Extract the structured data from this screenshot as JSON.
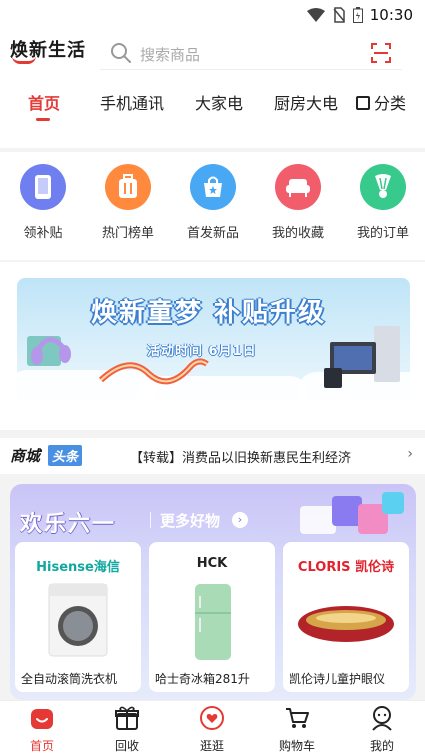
{
  "status_bar": {
    "time": "10:30"
  },
  "header": {
    "logo": "焕新生活",
    "search_placeholder": "搜索商品"
  },
  "tabs": [
    {
      "label": "首页",
      "active": true
    },
    {
      "label": "手机通讯",
      "active": false
    },
    {
      "label": "大家电",
      "active": false
    },
    {
      "label": "厨房大电",
      "active": false
    },
    {
      "label": "分类",
      "active": false
    }
  ],
  "quick_links": [
    {
      "label": "领补贴",
      "icon": "phone-icon",
      "color": "#6f7ff0"
    },
    {
      "label": "热门榜单",
      "icon": "suitcase-icon",
      "color": "#ff8a3d"
    },
    {
      "label": "首发新品",
      "icon": "shopping-bag-icon",
      "color": "#49a8f3"
    },
    {
      "label": "我的收藏",
      "icon": "sofa-icon",
      "color": "#f25d6c"
    },
    {
      "label": "我的订单",
      "icon": "badminton-icon",
      "color": "#38c98c"
    }
  ],
  "banner": {
    "title": "焕新童梦 补贴升级",
    "date": "活动时间 6月1日"
  },
  "news": {
    "logo": "商城",
    "tag": "头条",
    "text": "【转载】消费品以旧换新惠民生利经济"
  },
  "promo": {
    "title": "欢乐六一",
    "more": "更多好物",
    "products": [
      {
        "brand": "Hisense海信",
        "brand_color": "#11a8a0",
        "name": "全自动滚筒洗衣机"
      },
      {
        "brand": "HCK",
        "brand_color": "#222222",
        "name": "哈士奇冰箱281升"
      },
      {
        "brand": "CLORIS 凯伦诗",
        "brand_color": "#e2222c",
        "name": "凯伦诗儿童护眼仪"
      }
    ]
  },
  "bottom_nav": [
    {
      "label": "首页",
      "icon": "home-icon",
      "active": true
    },
    {
      "label": "回收",
      "icon": "gift-box-icon",
      "active": false
    },
    {
      "label": "逛逛",
      "icon": "heart-bubble-icon",
      "active": false
    },
    {
      "label": "购物车",
      "icon": "cart-icon",
      "active": false
    },
    {
      "label": "我的",
      "icon": "user-icon",
      "active": false
    }
  ],
  "colors": {
    "accent": "#e53935",
    "promo_bg": "#c9c4f6"
  }
}
